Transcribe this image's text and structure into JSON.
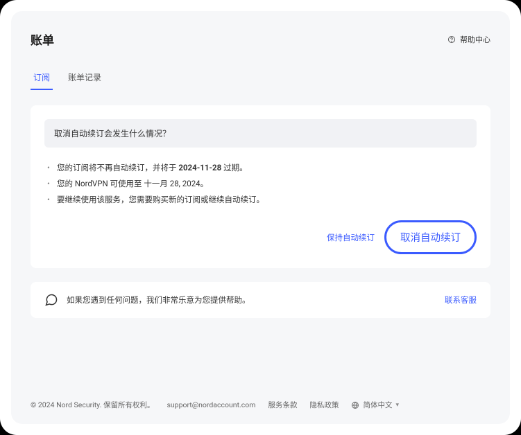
{
  "header": {
    "title": "账单",
    "help_label": "帮助中心"
  },
  "tabs": [
    {
      "label": "订阅",
      "active": true
    },
    {
      "label": "账单记录",
      "active": false
    }
  ],
  "card": {
    "question": "取消自动续订会发生什么情况？",
    "bullets": {
      "b1_pre": "您的订阅将不再自动续订，并将于 ",
      "b1_bold": "2024-11-28",
      "b1_post": " 过期。",
      "b2": "您的 NordVPN 可使用至 十一月 28, 2024。",
      "b3": "要继续使用该服务，您需要购买新的订阅或继续自动续订。"
    },
    "keep_label": "保持自动续订",
    "cancel_label": "取消自动续订"
  },
  "support": {
    "text": "如果您遇到任何问题，我们非常乐意为您提供帮助。",
    "link": "联系客服"
  },
  "footer": {
    "copyright": "© 2024 Nord Security. 保留所有权利。",
    "email": "support@nordaccount.com",
    "terms": "服务条款",
    "privacy": "隐私政策",
    "language": "简体中文"
  }
}
